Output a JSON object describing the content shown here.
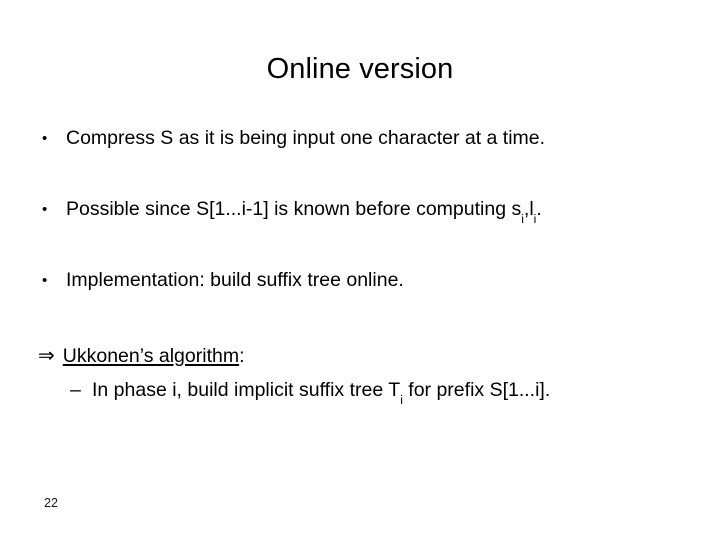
{
  "slide": {
    "title": "Online version",
    "page_number": "22",
    "background_color": "#ffffff",
    "text_color": "#000000"
  },
  "bullets": [
    {
      "marker": "•",
      "text": "Compress S as it is being input one character at a time."
    },
    {
      "marker": "•",
      "text_before": "Possible since S[1...i-1] is known before computing s",
      "sub_1": "i",
      "text_mid": ",l",
      "sub_2": "i",
      "text_after": "."
    },
    {
      "marker": "•",
      "text": "Implementation: build suffix tree online."
    }
  ],
  "conclusion": {
    "arrow_glyph": "⇒",
    "underlined_label": "Ukkonen’s algorithm",
    "colon": ":",
    "sub_item": {
      "marker": "–",
      "text_before": "In phase i, build implicit suffix tree T",
      "sub": "i",
      "text_after": " for prefix S[1...i]."
    }
  }
}
